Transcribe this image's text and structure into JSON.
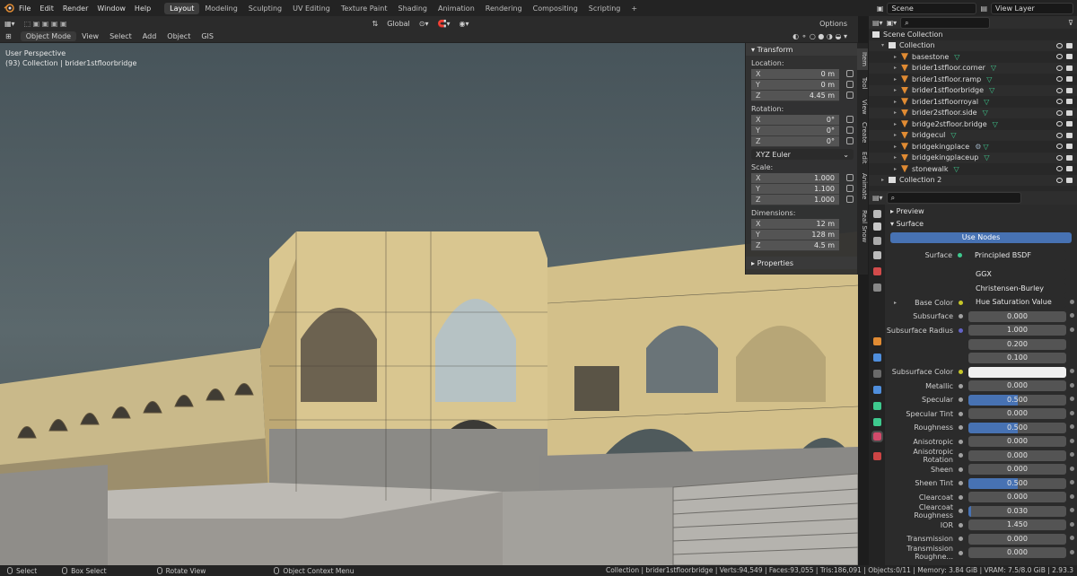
{
  "topbar": {
    "menus": [
      "File",
      "Edit",
      "Render",
      "Window",
      "Help"
    ],
    "workspaces": [
      "Layout",
      "Modeling",
      "Sculpting",
      "UV Editing",
      "Texture Paint",
      "Shading",
      "Animation",
      "Rendering",
      "Compositing",
      "Scripting",
      "+"
    ],
    "active_workspace": "Layout",
    "scene": "Scene",
    "view_layer": "View Layer"
  },
  "viewport_header": {
    "mode": "Object Mode",
    "menus": [
      "View",
      "Select",
      "Add",
      "Object",
      "GIS"
    ],
    "orientation": "Global",
    "options": "Options"
  },
  "viewport": {
    "title": "User Perspective",
    "subtitle": "(93) Collection | brider1stfloorbridge"
  },
  "npanel": {
    "transform": "Transform",
    "location_label": "Location:",
    "location": [
      {
        "k": "X",
        "v": "0 m"
      },
      {
        "k": "Y",
        "v": "0 m"
      },
      {
        "k": "Z",
        "v": "4.45 m"
      }
    ],
    "rotation_label": "Rotation:",
    "rotation": [
      {
        "k": "X",
        "v": "0°"
      },
      {
        "k": "Y",
        "v": "0°"
      },
      {
        "k": "Z",
        "v": "0°"
      }
    ],
    "rotation_mode": "XYZ Euler",
    "scale_label": "Scale:",
    "scale": [
      {
        "k": "X",
        "v": "1.000"
      },
      {
        "k": "Y",
        "v": "1.100"
      },
      {
        "k": "Z",
        "v": "1.000"
      }
    ],
    "dimensions_label": "Dimensions:",
    "dimensions": [
      {
        "k": "X",
        "v": "12 m"
      },
      {
        "k": "Y",
        "v": "128 m"
      },
      {
        "k": "Z",
        "v": "4.5 m"
      }
    ],
    "properties": "Properties",
    "tabs": [
      "Item",
      "Tool",
      "View",
      "Create",
      "Edit",
      "Animate",
      "Real Snow"
    ]
  },
  "outliner": {
    "scene_collection": "Scene Collection",
    "collection": "Collection",
    "items": [
      "basestone",
      "brider1stfloor.corner",
      "brider1stfloor.ramp",
      "brider1stfloorbridge",
      "brider1stfloorroyal",
      "brider2stfloor.side",
      "bridge2stfloor.bridge",
      "bridgecul",
      "bridgekingplace",
      "bridgekingplaceup",
      "stonewalk"
    ],
    "collection2": "Collection 2"
  },
  "material": {
    "preview": "Preview",
    "surface_section": "Surface",
    "use_nodes": "Use Nodes",
    "surface_label": "Surface",
    "surface_shader": "Principled BSDF",
    "distribution": "GGX",
    "subsurface_method": "Christensen-Burley",
    "rows": [
      {
        "label": "Base Color",
        "value": "Hue Saturation Value",
        "kind": "link"
      },
      {
        "label": "Subsurface",
        "value": "0.000"
      },
      {
        "label": "Subsurface Radius",
        "value": "1.000",
        "kind": "vec"
      },
      {
        "label": "",
        "value": "0.200",
        "kind": "vec"
      },
      {
        "label": "",
        "value": "0.100",
        "kind": "vec"
      },
      {
        "label": "Subsurface Color",
        "value": "",
        "kind": "white"
      },
      {
        "label": "Metallic",
        "value": "0.000"
      },
      {
        "label": "Specular",
        "value": "0.500",
        "fill": 0.5
      },
      {
        "label": "Specular Tint",
        "value": "0.000"
      },
      {
        "label": "Roughness",
        "value": "0.500",
        "fill": 0.5
      },
      {
        "label": "Anisotropic",
        "value": "0.000"
      },
      {
        "label": "Anisotropic Rotation",
        "value": "0.000"
      },
      {
        "label": "Sheen",
        "value": "0.000"
      },
      {
        "label": "Sheen Tint",
        "value": "0.500",
        "fill": 0.5
      },
      {
        "label": "Clearcoat",
        "value": "0.000"
      },
      {
        "label": "Clearcoat Roughness",
        "value": "0.030",
        "fill": 0.03
      },
      {
        "label": "IOR",
        "value": "1.450"
      },
      {
        "label": "Transmission",
        "value": "0.000"
      },
      {
        "label": "Transmission Roughne...",
        "value": "0.000"
      }
    ]
  },
  "statusbar": {
    "select": "Select",
    "box_select": "Box Select",
    "rotate_view": "Rotate View",
    "context_menu": "Object Context Menu",
    "stats": "Collection | brider1stfloorbridge | Verts:94,549 | Faces:93,055 | Tris:186,091 | Objects:0/11 | Memory: 3.84 GiB | VRAM: 7.5/8.0 GiB | 2.93.3"
  }
}
